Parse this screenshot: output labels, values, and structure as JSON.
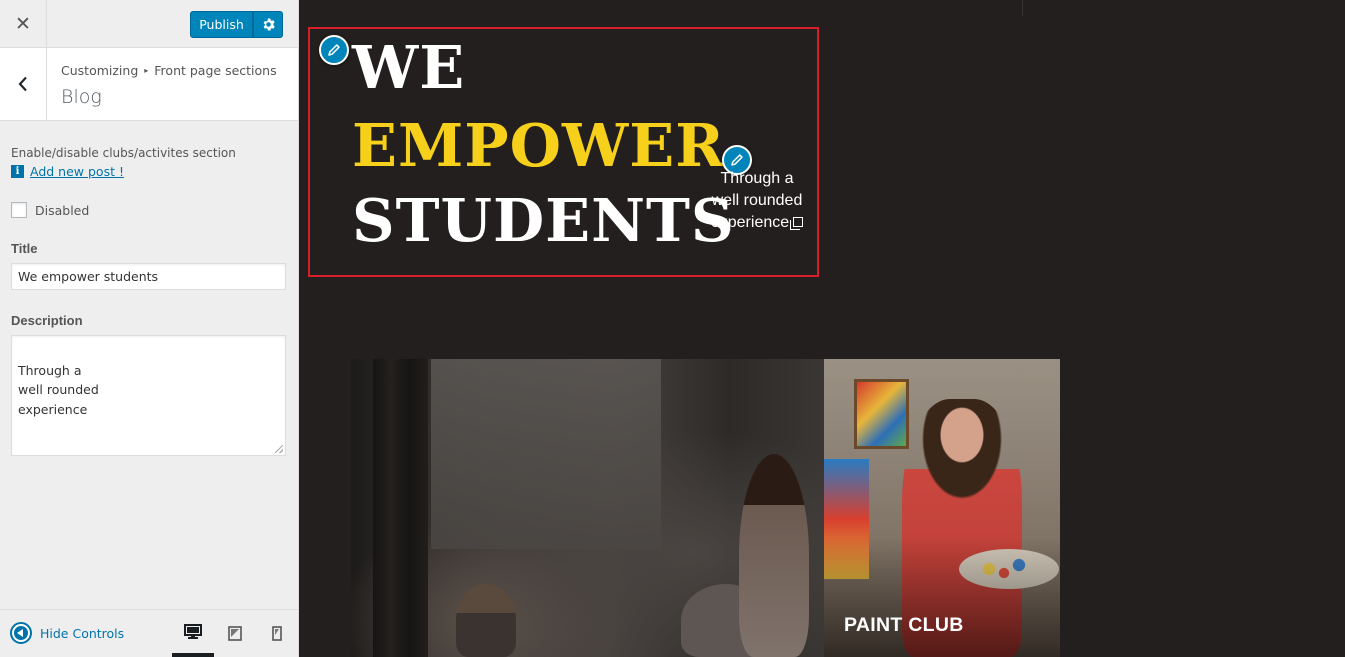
{
  "topbar": {
    "close_icon": "close-icon",
    "publish_label": "Publish",
    "settings_icon": "gear-icon"
  },
  "section": {
    "breadcrumb_root": "Customizing",
    "breadcrumb_parent": "Front page sections",
    "title": "Blog"
  },
  "controls": {
    "section_toggle_description": "Enable/disable clubs/activites section",
    "add_post_link": "Add new post !",
    "disabled_label": "Disabled",
    "disabled_checked": false,
    "title_label": "Title",
    "title_value": "We empower students",
    "description_label": "Description",
    "description_value": "Through a\nwell rounded\nexperience"
  },
  "footer": {
    "hide_controls_label": "Hide Controls",
    "devices": [
      "desktop",
      "tablet",
      "mobile"
    ],
    "active_device": "desktop"
  },
  "preview": {
    "hero_line_1": "WE",
    "hero_line_2": "EMPOWER",
    "hero_line_3": "STUDENTS",
    "hero_description": "Through a\nwell rounded\nexperience",
    "highlight_color": "#f6d01a",
    "text_color": "#ffffff",
    "selection_border_color": "#d71e28",
    "club_label": "PAINT CLUB"
  },
  "colors": {
    "accent": "#0085ba",
    "preview_background": "#231f1e",
    "sidebar_background": "#eeeeee"
  }
}
